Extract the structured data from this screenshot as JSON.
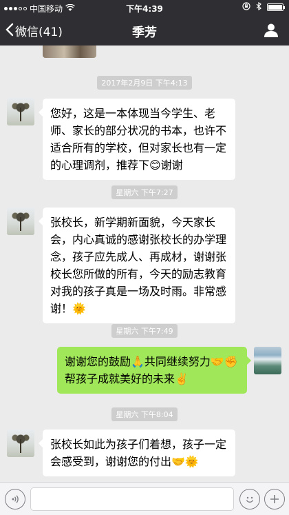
{
  "status_bar": {
    "carrier": "中国移动",
    "time": "下午4:39"
  },
  "nav": {
    "back_label": "微信(41)",
    "title": "季芳"
  },
  "messages": [
    {
      "timestamp": "2017年2月9日 下午4:13",
      "text": "您好，这是一本体现当今学生、老师、家长的部分状况的书本，也许不适合所有的学校，但对家长也有一定的心理调剂，推荐下😊谢谢"
    },
    {
      "timestamp": "星期六 下午7:27",
      "text": "张校长，新学期新面貌，今天家长会，内心真诚的感谢张校长的办学理念，孩子应先成人、再成材，谢谢张校长您所做的所有，今天的励志教育对我的孩子真是一场及时雨。非常感谢！🌞"
    },
    {
      "timestamp": "星期六 下午7:49",
      "text": "谢谢您的鼓励🙏共同继续努力🤝✊帮孩子成就美好的未来✌️"
    },
    {
      "timestamp": "星期六 下午8:04",
      "text": "张校长如此为孩子们着想，孩子一定会感受到，谢谢您的付出🤝🌞"
    }
  ],
  "colors": {
    "bar_bg": "#2f2f33",
    "chat_bg": "#ebebeb",
    "outgoing_bubble": "#a0e759",
    "incoming_bubble": "#ffffff"
  },
  "icons": {
    "back": "chevron-left-icon",
    "profile": "person-icon",
    "voice": "voice-icon",
    "emoji": "smiley-icon",
    "more": "plus-icon"
  }
}
